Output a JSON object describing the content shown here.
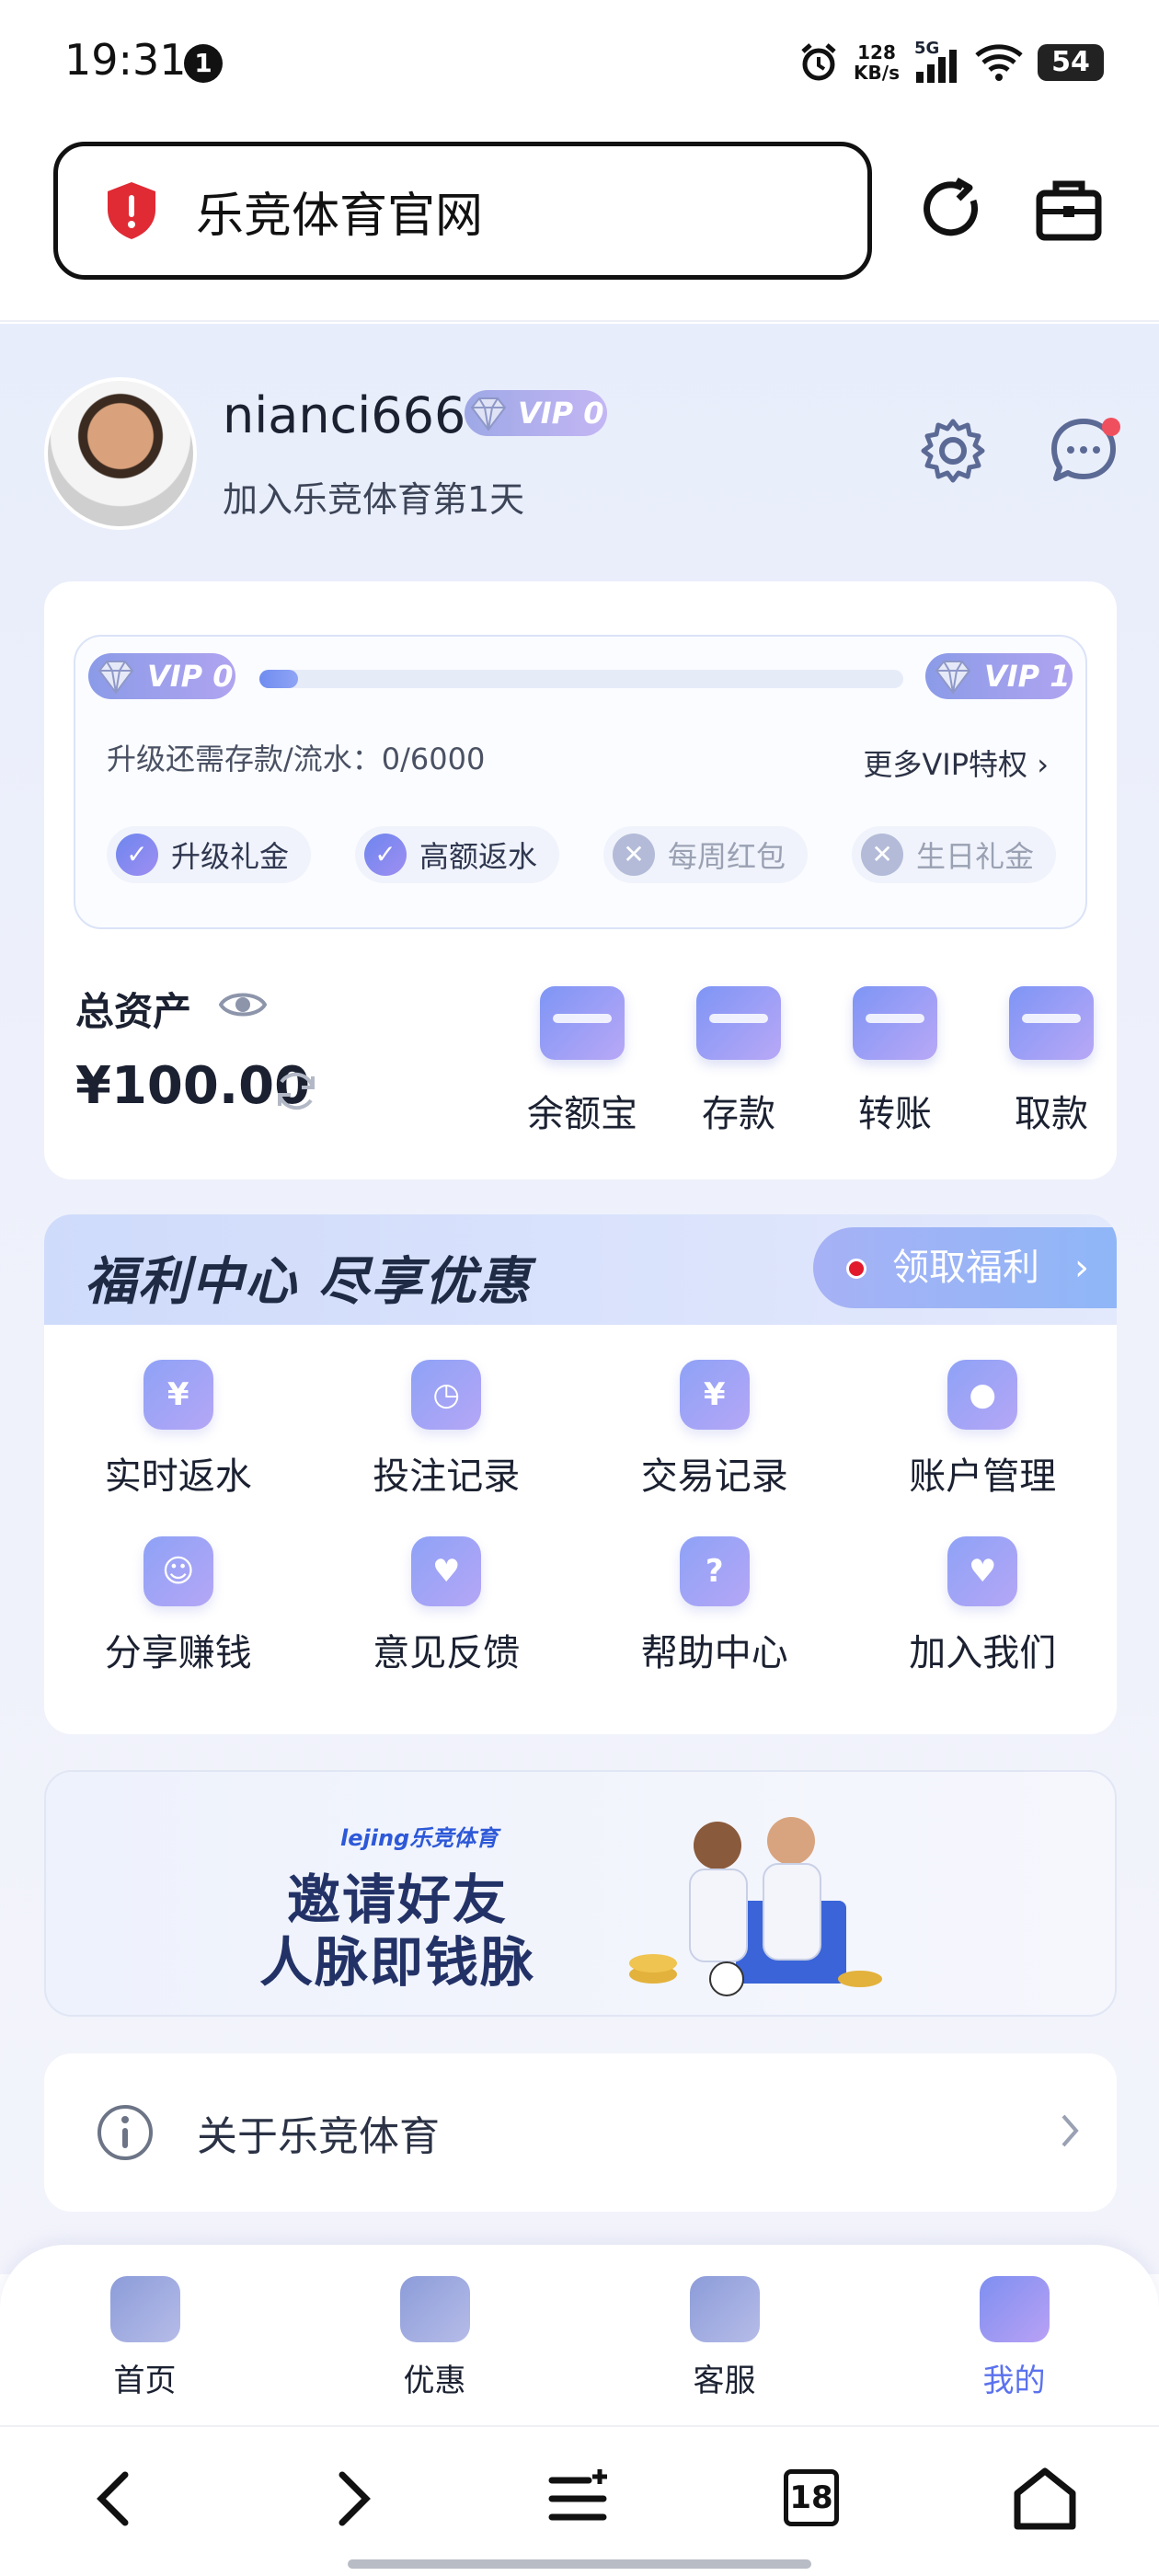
{
  "status_bar": {
    "time": "19:31",
    "notification_count": "1",
    "net_speed_value": "128",
    "net_speed_unit": "KB/s",
    "signal": "5G",
    "battery": "54"
  },
  "browser": {
    "url_title": "乐竞体育官网",
    "tab_count": "18"
  },
  "profile": {
    "username": "nianci666",
    "vip_badge": "VIP 0",
    "join_text": "加入乐竞体育第1天"
  },
  "vip_card": {
    "current_level": "VIP 0",
    "next_level": "VIP 1",
    "progress_fraction": 0.05,
    "upgrade_label": "升级还需存款/流水：0/6000",
    "more_privileges": "更多VIP特权",
    "perks": [
      {
        "label": "升级礼金",
        "enabled": true
      },
      {
        "label": "高额返水",
        "enabled": true
      },
      {
        "label": "每周红包",
        "enabled": false
      },
      {
        "label": "生日礼金",
        "enabled": false
      }
    ]
  },
  "assets": {
    "label": "总资产",
    "balance": "¥100.00",
    "actions": [
      {
        "label": "余额宝",
        "icon": "wallet-yuan-icon"
      },
      {
        "label": "存款",
        "icon": "deposit-icon"
      },
      {
        "label": "转账",
        "icon": "transfer-icon"
      },
      {
        "label": "取款",
        "icon": "withdraw-icon"
      }
    ]
  },
  "welfare": {
    "title": "福利中心 尽享优惠",
    "claim_button": "领取福利",
    "items": [
      {
        "label": "实时返水",
        "icon": "money-bag-icon",
        "glyph": "¥"
      },
      {
        "label": "投注记录",
        "icon": "calendar-clock-icon",
        "glyph": "◷"
      },
      {
        "label": "交易记录",
        "icon": "calendar-yuan-icon",
        "glyph": "¥"
      },
      {
        "label": "账户管理",
        "icon": "user-hexagon-icon",
        "glyph": "●"
      },
      {
        "label": "分享赚钱",
        "icon": "share-earn-icon",
        "glyph": "☺"
      },
      {
        "label": "意见反馈",
        "icon": "feedback-heart-icon",
        "glyph": "♥"
      },
      {
        "label": "帮助中心",
        "icon": "help-question-icon",
        "glyph": "?"
      },
      {
        "label": "加入我们",
        "icon": "join-heart-icon",
        "glyph": "♥"
      }
    ]
  },
  "banner": {
    "brand": "lejing乐竞体育",
    "line1": "邀请好友",
    "line2": "人脉即钱脉"
  },
  "about": {
    "label": "关于乐竞体育"
  },
  "tab_bar": {
    "tabs": [
      {
        "label": "首页",
        "icon": "home-icon",
        "active": false
      },
      {
        "label": "优惠",
        "icon": "promo-ticket-icon",
        "active": false
      },
      {
        "label": "客服",
        "icon": "headset-icon",
        "active": false
      },
      {
        "label": "我的",
        "icon": "profile-icon",
        "active": true
      }
    ]
  },
  "colors": {
    "accent": "#5b72ee",
    "background": "#e8edfb",
    "notification_dot": "#f0505e",
    "shield": "#e02a34"
  }
}
